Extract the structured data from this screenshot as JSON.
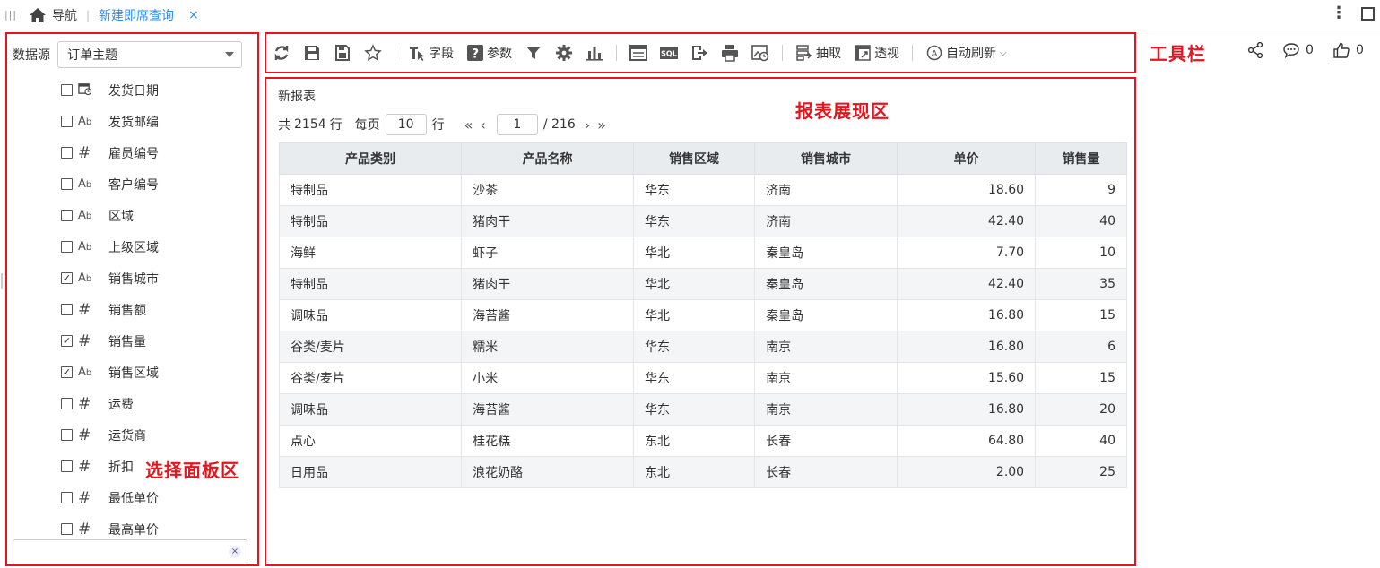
{
  "topbar": {
    "nav_label": "导航",
    "tab_label": "新建即席查询",
    "close_glyph": "×"
  },
  "annotations": {
    "toolbar": "工具栏",
    "report_area": "报表展现区",
    "select_panel": "选择面板区"
  },
  "panel": {
    "datasource_label": "数据源",
    "datasource_value": "订单主题",
    "fields": [
      {
        "name": "发货日期",
        "type": "date-icon",
        "checked": false
      },
      {
        "name": "发货邮编",
        "type": "text",
        "checked": false
      },
      {
        "name": "雇员编号",
        "type": "number",
        "checked": false
      },
      {
        "name": "客户编号",
        "type": "text",
        "checked": false
      },
      {
        "name": "区域",
        "type": "text",
        "checked": false
      },
      {
        "name": "上级区域",
        "type": "text",
        "checked": false
      },
      {
        "name": "销售城市",
        "type": "text",
        "checked": true
      },
      {
        "name": "销售额",
        "type": "number",
        "checked": false
      },
      {
        "name": "销售量",
        "type": "number",
        "checked": true
      },
      {
        "name": "销售区域",
        "type": "text",
        "checked": true
      },
      {
        "name": "运费",
        "type": "number",
        "checked": false
      },
      {
        "name": "运货商",
        "type": "number",
        "checked": false
      },
      {
        "name": "折扣",
        "type": "number",
        "checked": false
      },
      {
        "name": "最低单价",
        "type": "number",
        "checked": false
      },
      {
        "name": "最高单价",
        "type": "number",
        "checked": false
      }
    ],
    "search_placeholder": ""
  },
  "toolbar": {
    "field_label": "字段",
    "param_label": "参数",
    "extract_label": "抽取",
    "pivot_label": "透视",
    "autorefresh_label": "自动刷新",
    "sql_text": "SQL"
  },
  "social": {
    "comments": "0",
    "likes": "0"
  },
  "report": {
    "title": "新报表",
    "total_prefix": "共",
    "total_rows": "2154",
    "total_suffix": "行",
    "per_page_label": "每页",
    "per_page": "10",
    "per_page_suffix": "行",
    "current_page": "1",
    "total_pages": "/ 216",
    "columns": [
      "产品类别",
      "产品名称",
      "销售区域",
      "销售城市",
      "单价",
      "销售量"
    ],
    "rows": [
      [
        "特制品",
        "沙茶",
        "华东",
        "济南",
        "18.60",
        "9"
      ],
      [
        "特制品",
        "猪肉干",
        "华东",
        "济南",
        "42.40",
        "40"
      ],
      [
        "海鲜",
        "虾子",
        "华北",
        "秦皇岛",
        "7.70",
        "10"
      ],
      [
        "特制品",
        "猪肉干",
        "华北",
        "秦皇岛",
        "42.40",
        "35"
      ],
      [
        "调味品",
        "海苔酱",
        "华北",
        "秦皇岛",
        "16.80",
        "15"
      ],
      [
        "谷类/麦片",
        "糯米",
        "华东",
        "南京",
        "16.80",
        "6"
      ],
      [
        "谷类/麦片",
        "小米",
        "华东",
        "南京",
        "15.60",
        "15"
      ],
      [
        "调味品",
        "海苔酱",
        "华东",
        "南京",
        "16.80",
        "20"
      ],
      [
        "点心",
        "桂花糕",
        "东北",
        "长春",
        "64.80",
        "40"
      ],
      [
        "日用品",
        "浪花奶酪",
        "东北",
        "长春",
        "2.00",
        "25"
      ]
    ]
  },
  "colors": {
    "annotation_red": "#e3161f",
    "tab_blue": "#2d8cf0",
    "header_bg": "#e9ecef",
    "alt_row_bg": "#f4f5f7"
  }
}
